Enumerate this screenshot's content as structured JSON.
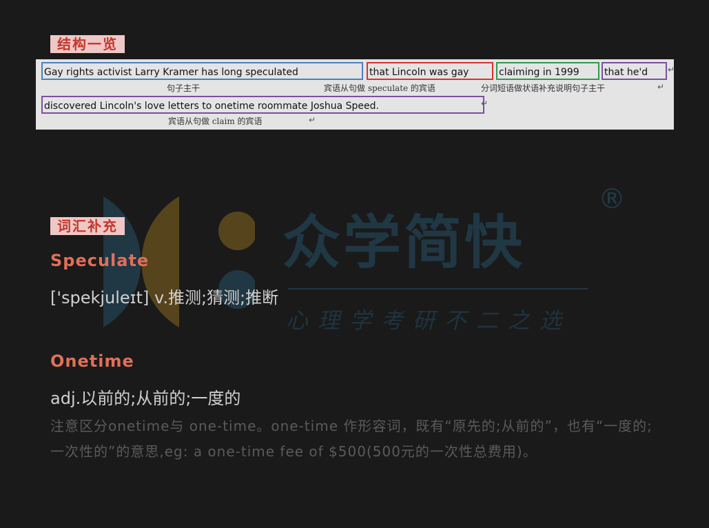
{
  "structure": {
    "label": "结构一览",
    "segments": [
      {
        "text": "Gay rights activist Larry Kramer has long speculated",
        "color": "#4a7fc1"
      },
      {
        "text": "that Lincoln was gay",
        "color": "#d93030"
      },
      {
        "text": "claiming in 1999",
        "color": "#2e9a4e"
      },
      {
        "text": "that he'd",
        "color": "#7a4fa0"
      },
      {
        "text": "discovered Lincoln's love letters to onetime roommate Joshua Speed.",
        "color": "#7a4fa0"
      }
    ],
    "notes": [
      "句子主干",
      "宾语从句做 speculate 的宾语",
      "分词短语做状语补充说明句子主干",
      "宾语从句做 claim 的宾语"
    ]
  },
  "vocab": {
    "label": "词汇补充",
    "words": [
      {
        "word": "Speculate",
        "definition": "['spekjuleɪt] v.推测;猜测;推断"
      },
      {
        "word": "Onetime",
        "definition": "adj.以前的;从前的;一度的"
      }
    ],
    "note": "注意区分onetime与 one-time。one-time 作形容词，既有“原先的;从前的”，也有“一度的;一次性的”的意思,eg: a one-time fee of $500(500元的一次性总费用)。"
  },
  "watermark": {
    "brand": "众学简快",
    "slogan": "心理学考研不二之选",
    "registered": "®"
  },
  "colors": {
    "accent": "#e0705a",
    "label_bg": "#f0c7c7",
    "label_text": "#c0392b",
    "background": "#1a1a1a"
  }
}
